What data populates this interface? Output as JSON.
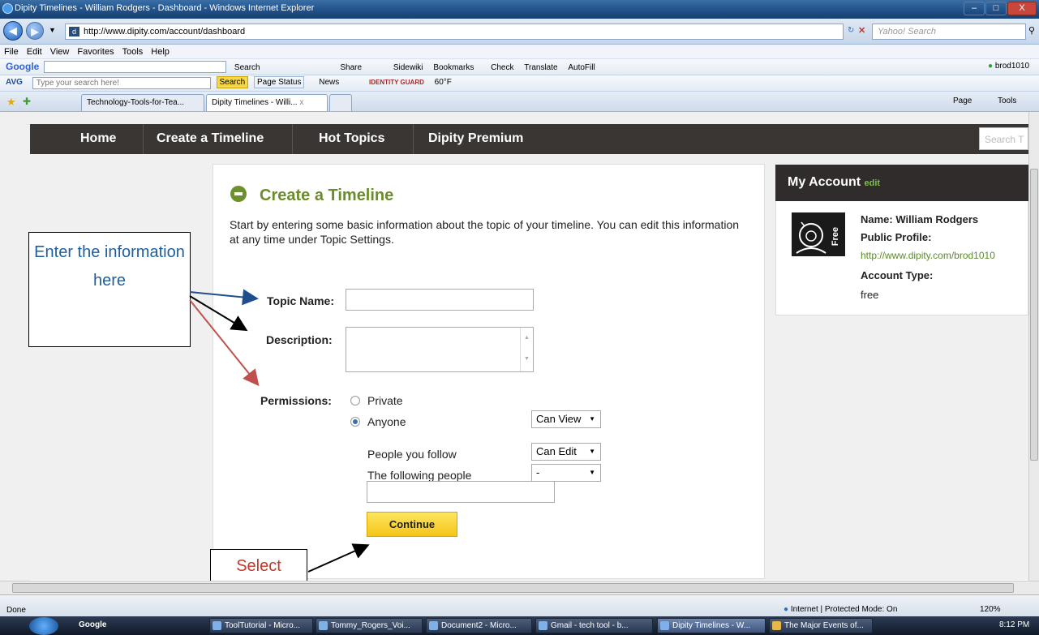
{
  "window": {
    "title": "Dipity Timelines - William Rodgers - Dashboard - Windows Internet Explorer",
    "min": "–",
    "max": "□",
    "close": "X"
  },
  "addressbar": {
    "url": "http://www.dipity.com/account/dashboard",
    "search_placeholder": "Yahoo! Search"
  },
  "menu": [
    "File",
    "Edit",
    "View",
    "Favorites",
    "Tools",
    "Help"
  ],
  "google_toolbar": {
    "logo": "Google",
    "items": [
      "Search",
      "Share",
      "Sidewiki",
      "Bookmarks",
      "Check",
      "Translate",
      "AutoFill"
    ],
    "user": "brod1010"
  },
  "avg_toolbar": {
    "logo": "AVG",
    "placeholder": "Type your search here!",
    "search": "Search",
    "page_status": "Page Status",
    "news": "News",
    "identity": "IDENTITY GUARD",
    "weather": "60°F"
  },
  "tabs": {
    "tab1": "Technology-Tools-for-Tea...",
    "tab2": "Dipity Timelines - Willi...",
    "close": "x",
    "commands": [
      "Page",
      "Tools"
    ]
  },
  "sitenav": {
    "items": [
      "Home",
      "Create a Timeline",
      "Hot Topics",
      "Dipity Premium"
    ],
    "search_placeholder": "Search T"
  },
  "form": {
    "heading": "Create a Timeline",
    "intro": "Start by entering some basic information about the topic of your timeline. You can edit this information at any time under Topic Settings.",
    "topic_label": "Topic Name:",
    "description_label": "Description:",
    "permissions_label": "Permissions:",
    "private": "Private",
    "anyone": "Anyone",
    "anyone_value": "Can View",
    "people_follow": "People you follow",
    "people_follow_value": "Can Edit",
    "following_people": "The following people",
    "following_people_value": "-",
    "continue": "Continue"
  },
  "account": {
    "heading": "My Account",
    "edit": "edit",
    "avatar_text": "Free",
    "name_label": "Name:",
    "name": "William Rodgers",
    "profile_label": "Public Profile:",
    "profile_url": "http://www.dipity.com/brod1010",
    "type_label": "Account Type:",
    "type": "free"
  },
  "annotations": {
    "enter_info": "Enter the information here",
    "select": "Select"
  },
  "colors": {
    "arrow_blue": "#1f4e8c",
    "arrow_black": "#000000",
    "arrow_red": "#c0504d",
    "heading_green": "#6b8c2a",
    "continue_yellow": "#f4c518"
  },
  "statusbar": {
    "left": "Done",
    "zone": "Internet | Protected Mode: On",
    "zoom": "120%"
  },
  "taskbar": {
    "google": "Google",
    "items": [
      "ToolTutorial - Micro...",
      "Tommy_Rogers_Voi...",
      "Document2 - Micro...",
      "Gmail - tech tool - b...",
      "Dipity Timelines - W...",
      "The Major Events of..."
    ],
    "time": "8:12 PM"
  }
}
